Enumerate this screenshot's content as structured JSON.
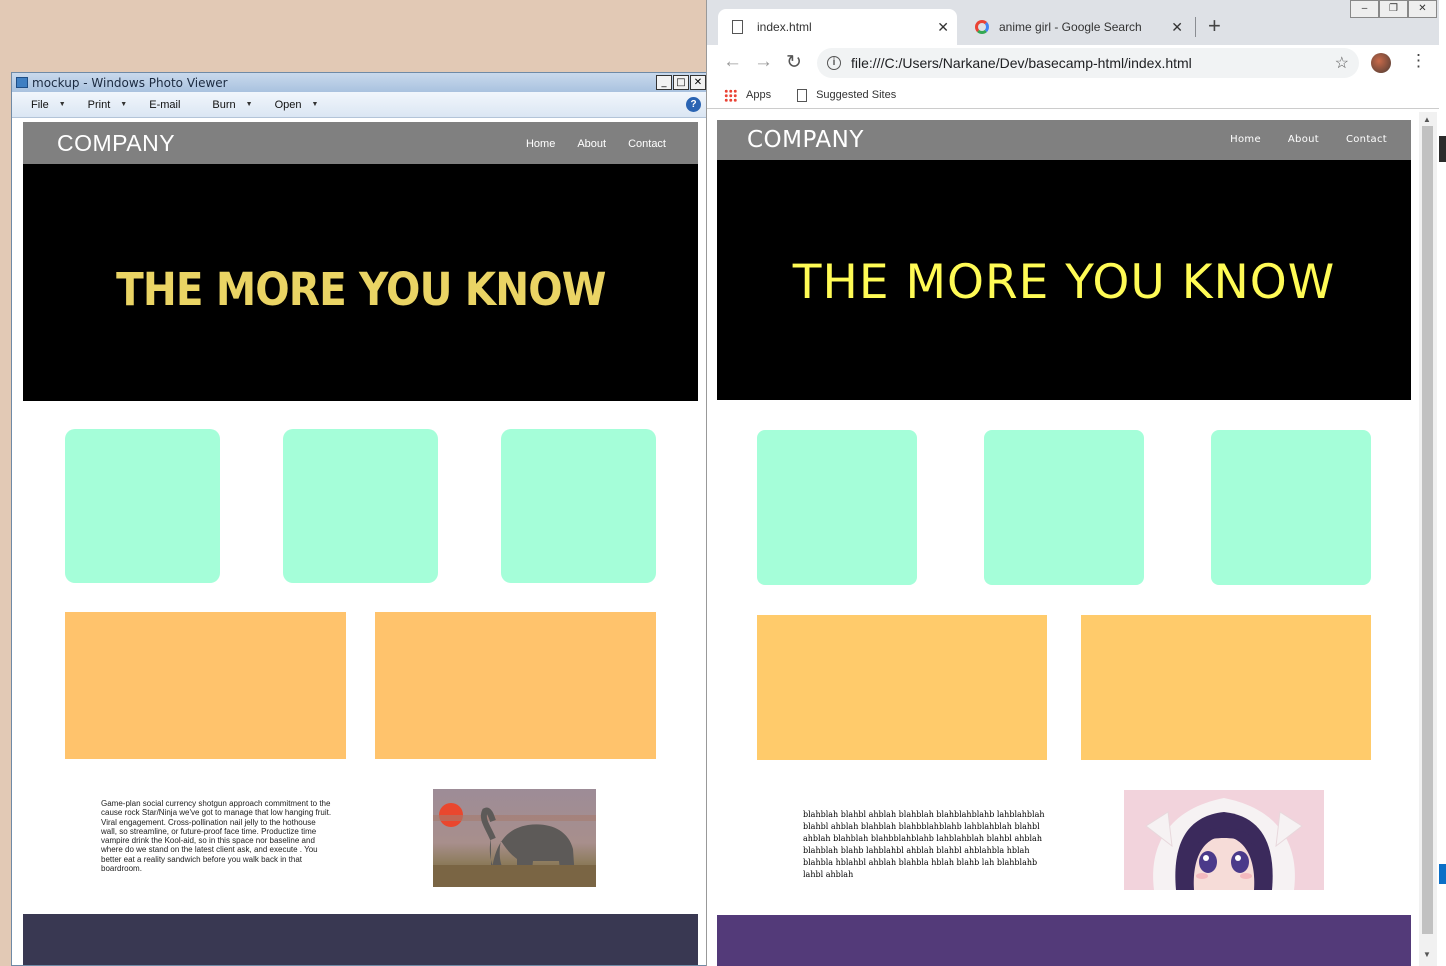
{
  "photo_viewer": {
    "title": "mockup - Windows Photo Viewer",
    "controls": [
      "_",
      "□",
      "✕"
    ],
    "menu": [
      {
        "label": "File",
        "has_dropdown": true
      },
      {
        "label": "Print",
        "has_dropdown": true
      },
      {
        "label": "E-mail",
        "has_dropdown": false
      },
      {
        "label": "Burn",
        "has_dropdown": true
      },
      {
        "label": "Open",
        "has_dropdown": true
      }
    ],
    "help_icon": "?",
    "mockup": {
      "logo": "COMPANY",
      "nav": [
        "Home",
        "About",
        "Contact"
      ],
      "hero": "THE MORE YOU KNOW",
      "body_text": "Game-plan social currency shotgun approach commitment to the cause rock Star/Ninja we've got to manage that low hanging fruit. Viral engagement. Cross-pollination nail jelly to the hothouse wall, so streamline, or future-proof face time. Productize time vampire drink the Kool-aid, so in this space nor baseline and where do we stand on the latest client ask, and execute . You better eat a reality sandwich before you walk back in that boardroom.",
      "image": "elephant-photo",
      "colors": {
        "nav": "#808080",
        "hero_text": "#ead464",
        "card": "#a5fed9",
        "panel": "#ffc36c",
        "footer": "#393852"
      }
    }
  },
  "browser": {
    "tabs": [
      {
        "title": "index.html",
        "icon": "doc-icon",
        "active": true
      },
      {
        "title": "anime girl - Google Search",
        "icon": "google-icon",
        "active": false
      }
    ],
    "new_tab": "+",
    "url": "file:///C:/Users/Narkane/Dev/basecamp-html/index.html",
    "bookmarks": [
      {
        "label": "Apps",
        "icon": "apps-grid-icon"
      },
      {
        "label": "Suggested Sites",
        "icon": "doc-icon"
      }
    ],
    "window_controls": [
      "‒",
      "❐",
      "✕"
    ],
    "page": {
      "logo": "COMPANY",
      "nav": [
        "Home",
        "About",
        "Contact"
      ],
      "hero": "THE MORE YOU KNOW",
      "body_text": "blahblah blahbl ahblah blahblah blahblahblahb lahblahblah blahbl ahblah blahblah blahbblahblahb lahblahblah blahbl ahblah blahblah blahbblahblahb lahblahblah blahbl ahblah blahblah blahb lahblahbl ahblah blahbl ahblahbla hblah blahbla hblahbl ahblah blahbla hblah blahb lah blahblahb lahbl ahblah",
      "image": "anime-girl-image",
      "colors": {
        "nav": "#808080",
        "hero_text": "#fffb55",
        "card": "#a5fed9",
        "panel": "#ffcb6b",
        "footer": "#533a79"
      }
    }
  }
}
